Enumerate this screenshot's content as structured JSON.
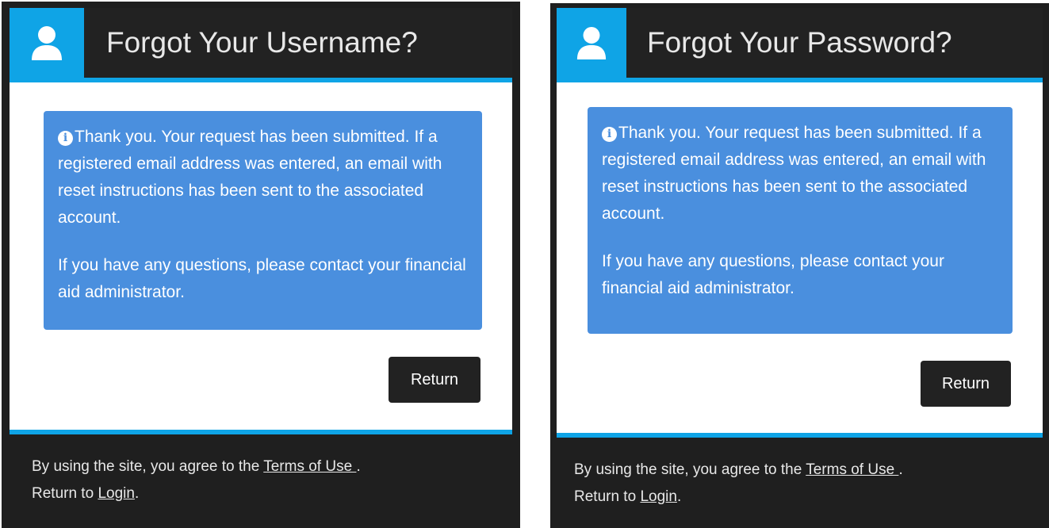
{
  "username_panel": {
    "title": "Forgot Your Username?",
    "icon": "user-icon",
    "message_p1": "Thank you. Your request has been submitted. If a registered email address was entered, an email with reset instructions has been sent to the associated account.",
    "message_p2": "If you have any questions, please contact your financial aid administrator.",
    "return_label": "Return",
    "footer_prefix": "By using the site, you agree to the ",
    "terms_link": "Terms of Use ",
    "footer_suffix": ".",
    "return_to_prefix": "Return to ",
    "login_link": "Login",
    "return_to_suffix": "."
  },
  "password_panel": {
    "title": "Forgot Your Password?",
    "icon": "user-icon",
    "message_p1": "Thank you. Your request has been submitted. If a registered email address was entered, an email with reset instructions has been sent to the associated account.",
    "message_p2": "If you have any questions, please contact your financial aid administrator.",
    "return_label": "Return",
    "footer_prefix": "By using the site, you agree to the ",
    "terms_link": "Terms of Use ",
    "footer_suffix": ".",
    "return_to_prefix": "Return to ",
    "login_link": "Login",
    "return_to_suffix": "."
  },
  "colors": {
    "accent": "#0fa4e6",
    "alert_bg": "#4a8fde",
    "dark": "#222222"
  }
}
